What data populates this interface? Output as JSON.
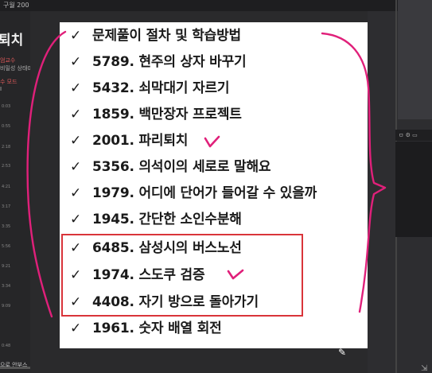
{
  "topbar": {
    "title": "구월 200"
  },
  "sidebar": {
    "title": "퇴치",
    "professor": "엄교수",
    "state": "비밀성 상태0",
    "section": "수 모드",
    "section2": "I",
    "rows": [
      "0:03",
      "0:55",
      "2:18",
      "2:53",
      "4:21",
      "3:17",
      "3:35",
      "5:56",
      "9:21",
      "3:34",
      "9:09",
      "0:48"
    ],
    "footer": "으로 안부스"
  },
  "rightpanel": {
    "bar_label": "ㅁ ⚙ ▭"
  },
  "slide": {
    "items": [
      "문제풀이 절차 및 학습방법",
      "5789. 현주의 상자 바꾸기",
      "5432. 쇠막대기 자르기",
      "1859. 백만장자 프로젝트",
      "2001. 파리퇴치",
      "5356. 의석이의 세로로 말해요",
      "1979. 어디에 단어가 들어갈 수 있을까",
      "1945. 간단한 소인수분해",
      "6485. 삼성시의 버스노선",
      "1974. 스도쿠 검증",
      "4408. 자기 방으로 돌아가기",
      "1961. 숫자 배열 회전"
    ],
    "check": "✓"
  },
  "colors": {
    "annotation_pink": "#e0207a",
    "box_red": "#d9343a"
  }
}
